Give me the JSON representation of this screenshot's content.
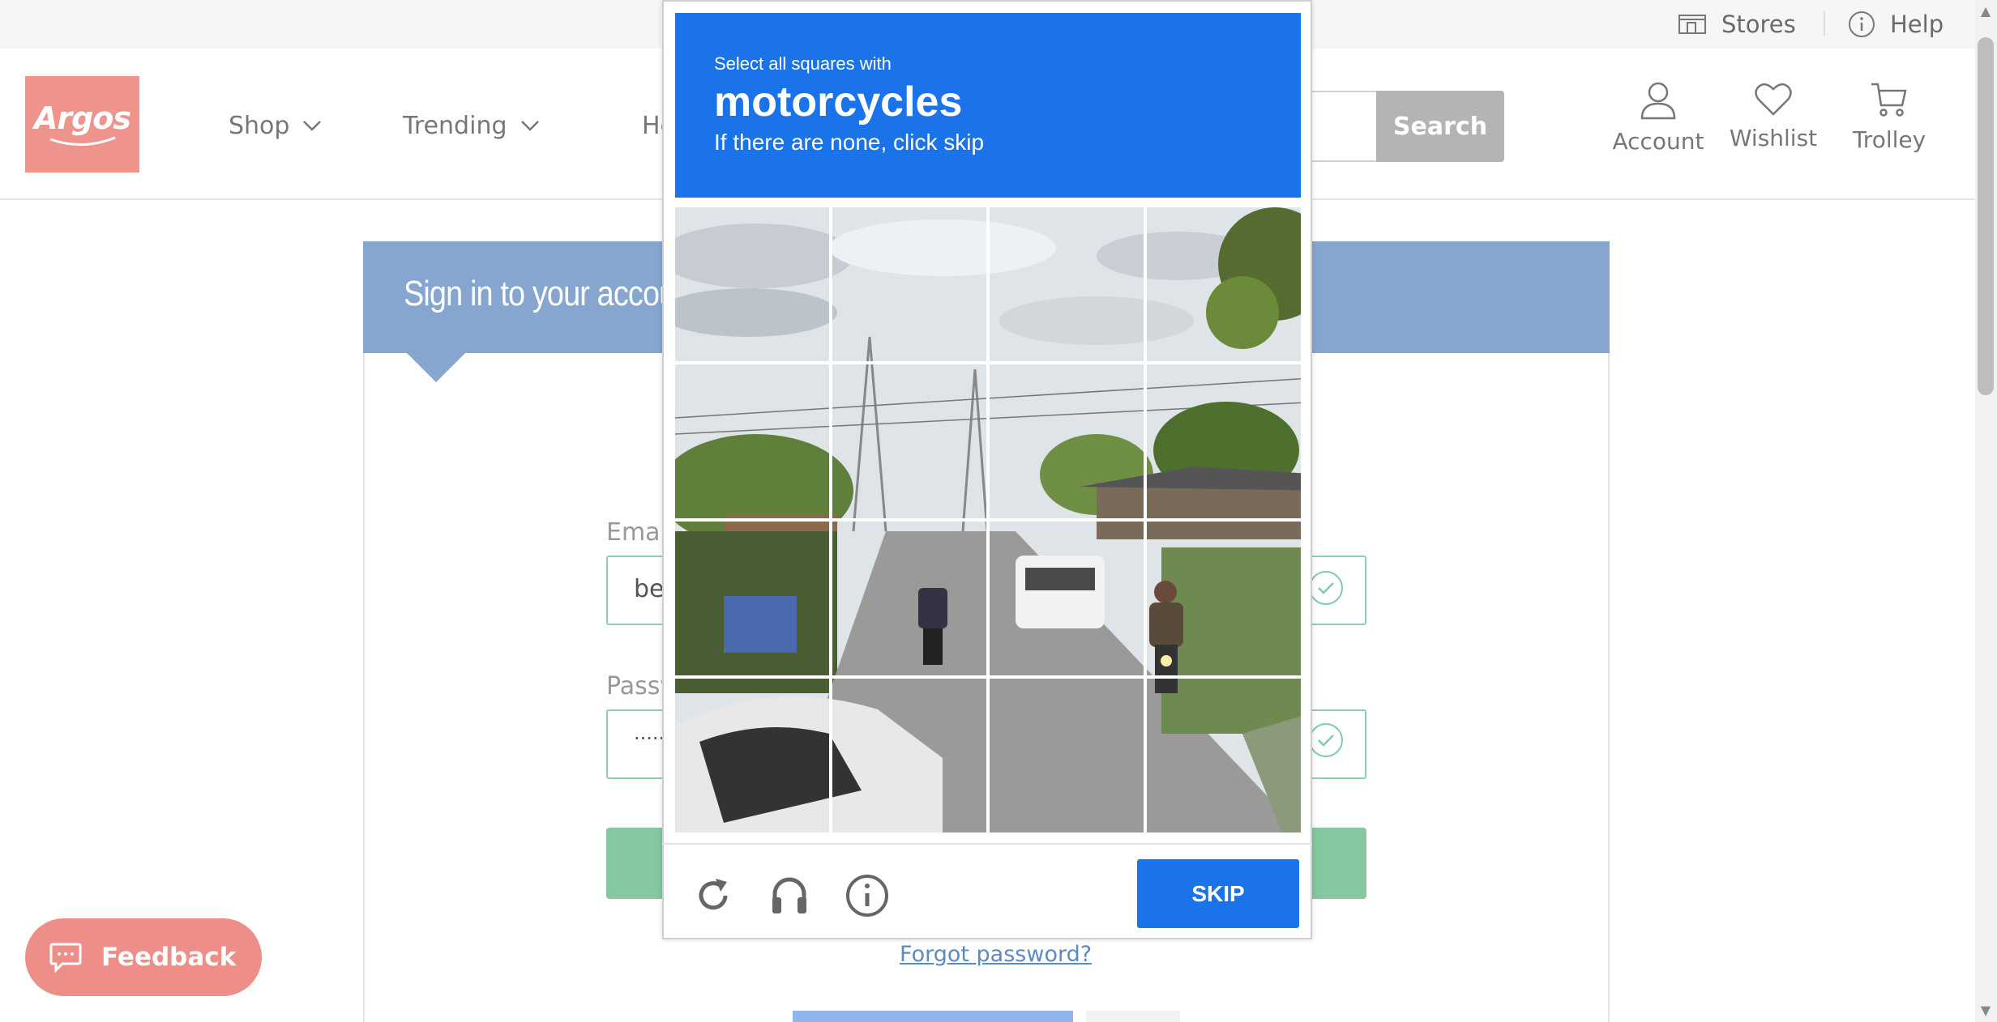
{
  "utility_bar": {
    "stores_label": "Stores",
    "help_label": "Help"
  },
  "header": {
    "logo_text": "Argos",
    "nav": [
      {
        "label": "Shop",
        "icon": "chevron-down-icon"
      },
      {
        "label": "Trending",
        "icon": "chevron-down-icon"
      },
      {
        "label": "He"
      }
    ],
    "search_button_label": "Search",
    "actions": [
      {
        "label": "Account",
        "icon": "user-icon"
      },
      {
        "label": "Wishlist",
        "icon": "heart-icon"
      },
      {
        "label": "Trolley",
        "icon": "trolley-icon"
      }
    ]
  },
  "signin": {
    "title": "Sign in to your accou",
    "email_label": "Emai",
    "email_value": "ben",
    "password_label": "Passv",
    "password_value": "·····",
    "forgot_password": "Forgot password?"
  },
  "feedback": {
    "label": "Feedback"
  },
  "captcha": {
    "instruction_small": "Select all squares with",
    "instruction_target": "motorcycles",
    "instruction_sub": "If there are none, click skip",
    "grid_rows": 4,
    "grid_cols": 4,
    "skip_label": "SKIP",
    "colors": {
      "header_blue": "#1a73e8"
    }
  },
  "colors": {
    "brand": "#ef938d",
    "card_header": "#86a6cf",
    "success": "#84c7a0"
  }
}
